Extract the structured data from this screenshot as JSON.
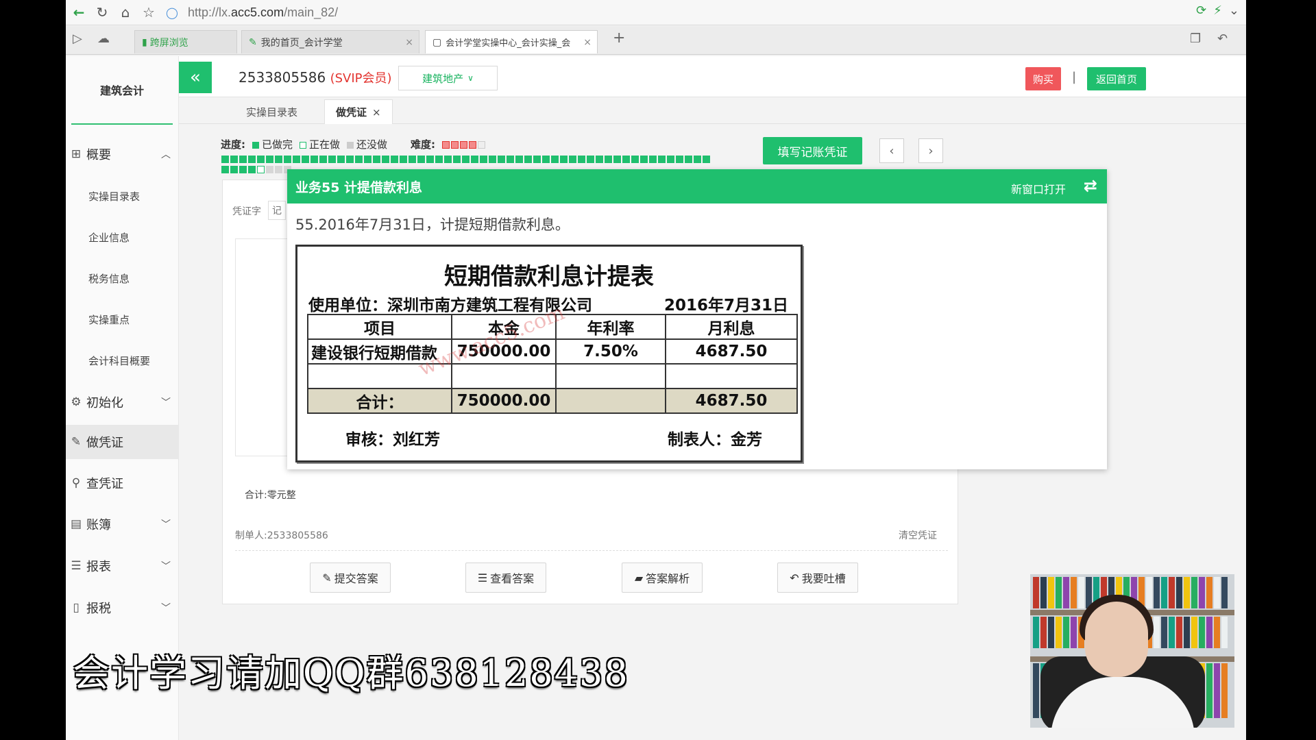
{
  "browser": {
    "url_prefix": "http://lx.",
    "url_domain": "acc5.com",
    "url_path": "/main_82/",
    "tabs": [
      {
        "label": "跨屏浏览"
      },
      {
        "label": "我的首页_会计学堂"
      },
      {
        "label": "会计学堂实操中心_会计实操_会"
      }
    ],
    "new_tab": "+"
  },
  "sidebar": {
    "brand": "建筑会计",
    "menu": [
      {
        "label": "概要",
        "icon": "grid-icon",
        "expanded": true
      },
      {
        "label": "初始化",
        "icon": "gear-icon"
      },
      {
        "label": "做凭证",
        "icon": "pen-icon",
        "active": true
      },
      {
        "label": "查凭证",
        "icon": "search-icon"
      },
      {
        "label": "账簿",
        "icon": "book-icon"
      },
      {
        "label": "报表",
        "icon": "report-icon"
      },
      {
        "label": "报税",
        "icon": "file-icon"
      }
    ],
    "submenu": [
      "实操目录表",
      "企业信息",
      "税务信息",
      "实操重点",
      "会计科目概要"
    ]
  },
  "header": {
    "account": "2533805586",
    "vip": "(SVIP会员)",
    "industry": "建筑地产",
    "buy": "购买",
    "separator": "|",
    "home": "返回首页",
    "collapse": "«"
  },
  "subtabs": [
    {
      "label": "实操目录表"
    },
    {
      "label": "做凭证",
      "close": "×"
    }
  ],
  "progress": {
    "label": "进度:",
    "done": "已做完",
    "doing": "正在做",
    "todo": "还没做",
    "difficulty_label": "难度:",
    "difficulty_stars": 4,
    "difficulty_max": 5,
    "fill_button": "填写记账凭证",
    "prev": "‹",
    "next": "›",
    "row1_done": 55,
    "row2_done": 4,
    "current_index": 59,
    "row2_todo": 3
  },
  "voucher": {
    "voucher_word_label": "凭证字",
    "voucher_word": "记",
    "total_label": "合计:零元整",
    "maker": "制单人:2533805586",
    "clear": "清空凭证",
    "buttons": [
      {
        "label": "提交答案",
        "icon": "edit-icon"
      },
      {
        "label": "查看答案",
        "icon": "list-icon"
      },
      {
        "label": "答案解析",
        "icon": "folder-icon"
      },
      {
        "label": "我要吐槽",
        "icon": "reply-icon"
      }
    ]
  },
  "popup": {
    "title": "业务55 计提借款利息",
    "new_window": "新窗口打开",
    "description": "55.2016年7月31日，计提短期借款利息。",
    "doc": {
      "title": "短期借款利息计提表",
      "unit": "使用单位：深圳市南方建筑工程有限公司",
      "date": "2016年7月31日",
      "headers": [
        "项目",
        "本金",
        "年利率",
        "月利息"
      ],
      "rows": [
        [
          "建设银行短期借款",
          "750000.00",
          "7.50%",
          "4687.50"
        ],
        [
          "",
          "",
          "",
          ""
        ]
      ],
      "total": [
        "合计：",
        "750000.00",
        "",
        "4687.50"
      ],
      "reviewer": "审核：刘红芳",
      "preparer": "制表人：金芳",
      "watermark": "www.acc5.com"
    }
  },
  "caption": "会计学习请加QQ群638128438",
  "colors": {
    "accent": "#1fbf6e",
    "danger": "#f0575b",
    "vip": "#e3342f"
  }
}
